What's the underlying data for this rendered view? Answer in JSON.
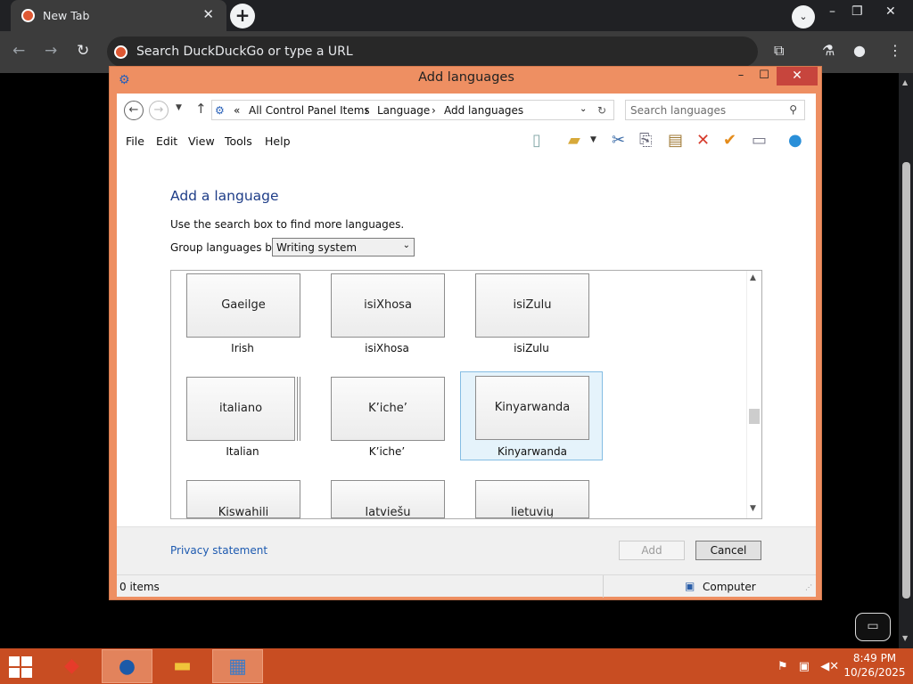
{
  "browser": {
    "tab_title": "New Tab",
    "tab_close": "✕",
    "new_tab": "+",
    "omnibox_placeholder": "Search DuckDuckGo or type a URL"
  },
  "dialog": {
    "title": "Add languages",
    "breadcrumb": [
      "«",
      "All Control Panel Items",
      "›",
      "Language",
      "›",
      "Add languages"
    ],
    "search_placeholder": "Search languages",
    "menu": [
      "File",
      "Edit",
      "View",
      "Tools",
      "Help"
    ],
    "heading": "Add a language",
    "hint": "Use the search box to find more languages.",
    "group_label": "Group languages by:",
    "group_value": "Writing system",
    "tiles": [
      {
        "native": "Gaeilge",
        "caption": "Irish",
        "selected": false,
        "stack": false
      },
      {
        "native": "isiXhosa",
        "caption": "isiXhosa",
        "selected": false,
        "stack": false
      },
      {
        "native": "isiZulu",
        "caption": "isiZulu",
        "selected": false,
        "stack": false
      },
      {
        "native": "italiano",
        "caption": "Italian",
        "selected": false,
        "stack": true
      },
      {
        "native": "K’iche’",
        "caption": "K’iche’",
        "selected": false,
        "stack": false
      },
      {
        "native": "Kinyarwanda",
        "caption": "Kinyarwanda",
        "selected": true,
        "stack": false
      },
      {
        "native": "Kiswahili",
        "caption": "",
        "selected": false,
        "stack": false
      },
      {
        "native": "latviešu",
        "caption": "",
        "selected": false,
        "stack": false
      },
      {
        "native": "lietuvių",
        "caption": "",
        "selected": false,
        "stack": false
      }
    ],
    "privacy_link": "Privacy statement",
    "add_button": "Add",
    "cancel_button": "Cancel",
    "status_items": "0 items",
    "status_location": "Computer"
  },
  "taskbar": {
    "time": "8:49 PM",
    "date": "10/26/2025"
  }
}
